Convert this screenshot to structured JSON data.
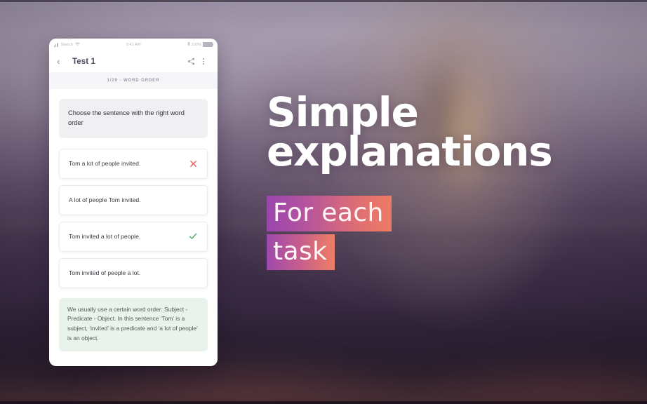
{
  "phone": {
    "status_bar": {
      "carrier": "Sketch",
      "wifi_icon": "wifi-icon",
      "time": "9:41 AM",
      "bluetooth_icon": "bluetooth-icon",
      "battery_percent": "100%"
    },
    "app_bar": {
      "back_icon": "chevron-left-icon",
      "title": "Test 1",
      "share_icon": "share-icon",
      "more_icon": "more-vertical-icon"
    },
    "progress_label": "1/20 - WORD ORDER",
    "question": "Choose the sentence with the right word order",
    "options": [
      {
        "text": "Tom a lot of people invited.",
        "mark": "incorrect"
      },
      {
        "text": "A lot of people Tom invited.",
        "mark": "none"
      },
      {
        "text": "Tom invited a lot of people.",
        "mark": "correct"
      },
      {
        "text": "Tom invited of people a lot.",
        "mark": "none"
      }
    ],
    "explanation": "We usually use a certain word order: Subject - Predicate - Object. In this sentence ‘Tom’ is a subject, ‘invited’ is a predicate and ‘a lot of people’ is an object."
  },
  "promo": {
    "headline_line1": "Simple",
    "headline_line2": "explanations",
    "sub_line1": "For each",
    "sub_line2": "task"
  },
  "colors": {
    "correct_green": "#3aa655",
    "incorrect_red": "#e8453c",
    "highlight_gradient_start": "#9a46ad",
    "highlight_gradient_end": "#ef7b63",
    "app_title": "#4e4660",
    "question_card_bg": "#f0f0f3",
    "explanation_bg": "#e9f3ec"
  }
}
